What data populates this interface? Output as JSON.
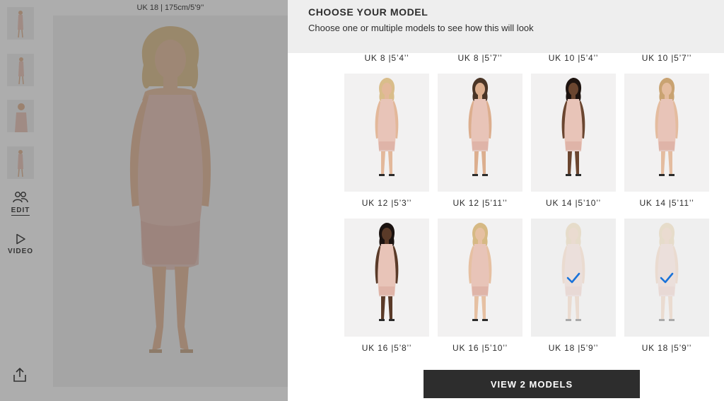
{
  "viewer": {
    "size_caption": "UK 18  |  175cm/5’9’’",
    "thumbnails": [
      "thumbnail-1",
      "thumbnail-2",
      "thumbnail-3",
      "thumbnail-4"
    ],
    "edit_label": "EDIT",
    "video_label": "VIDEO",
    "icons": {
      "edit": "people-icon",
      "video": "play-icon",
      "share": "share-icon"
    }
  },
  "panel": {
    "title": "CHOOSE YOUR MODEL",
    "subtitle": "Choose one or multiple models to see how this will look",
    "top_labels": [
      "UK 8 |5’4’’",
      "UK 8 |5’7’’",
      "UK 10 |5’4’’",
      "UK 10 |5’7’’"
    ],
    "models": [
      {
        "label": "UK 12 |5’3’’",
        "selected": false,
        "skin": "#e3b89a",
        "hair": "#d9bd8a"
      },
      {
        "label": "UK 12 |5’11’’",
        "selected": false,
        "skin": "#dcae8e",
        "hair": "#4a3526"
      },
      {
        "label": "UK 14 |5’10’’",
        "selected": false,
        "skin": "#6b4630",
        "hair": "#1e1410"
      },
      {
        "label": "UK 14 |5’11’’",
        "selected": false,
        "skin": "#e4bc9f",
        "hair": "#c9a372"
      },
      {
        "label": "UK 16 |5’8’’",
        "selected": false,
        "skin": "#5a3a28",
        "hair": "#1a1210"
      },
      {
        "label": "UK 16 |5’10’’",
        "selected": false,
        "skin": "#e6c0a2",
        "hair": "#d6b984"
      },
      {
        "label": "UK 18 |5’9’’",
        "selected": true,
        "skin": "#e3b89a",
        "hair": "#d9bd8a"
      },
      {
        "label": "UK 18 |5’9’’",
        "selected": true,
        "skin": "#e3b89a",
        "hair": "#d9bd8a"
      }
    ],
    "view_button": "VIEW 2 MODELS"
  },
  "colors": {
    "dress": "#e8c4b8",
    "dress_dark": "#d9aa9c",
    "check": "#1a73d9",
    "button": "#2d2d2d",
    "header_bg": "#eeeeee"
  }
}
